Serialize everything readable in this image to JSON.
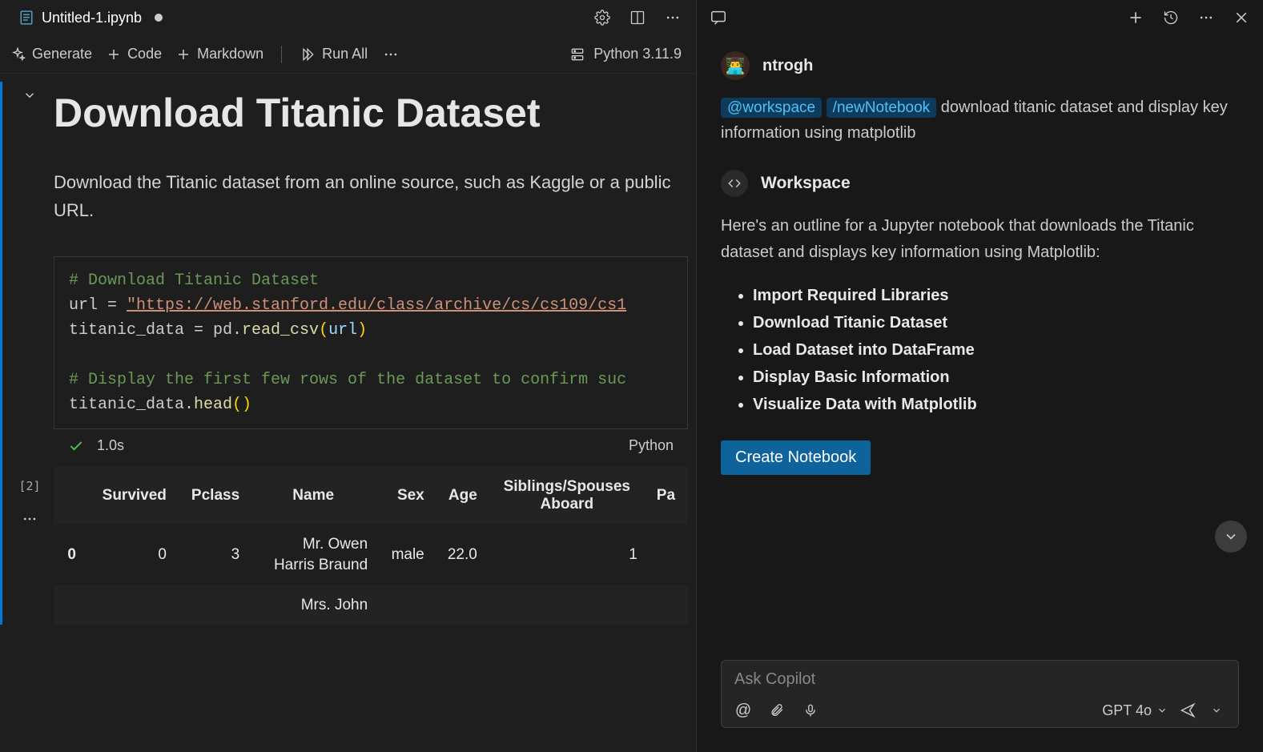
{
  "tab": {
    "filename": "Untitled-1.ipynb"
  },
  "toolbar": {
    "generate": "Generate",
    "code": "Code",
    "markdown": "Markdown",
    "runAll": "Run All",
    "kernel": "Python 3.11.9"
  },
  "notebook": {
    "heading": "Download Titanic Dataset",
    "paragraph": "Download the Titanic dataset from an online source, such as Kaggle or a public URL.",
    "exec_count": "[2]",
    "code": {
      "c1": "# Download Titanic Dataset",
      "l2a": "url = ",
      "l2b": "\"https://web.stanford.edu/class/archive/cs/cs109/cs1",
      "l3a": "titanic_data = pd.",
      "l3b": "read_csv",
      "l3c": "(",
      "l3d": "url",
      "l3e": ")",
      "c2": "# Display the first few rows of the dataset to confirm suc",
      "l5a": "titanic_data.",
      "l5b": "head",
      "l5c": "()"
    },
    "exec_time": "1.0s",
    "language": "Python",
    "table": {
      "headers": [
        "Survived",
        "Pclass",
        "Name",
        "Sex",
        "Age",
        "Siblings/Spouses Aboard",
        "Pa"
      ],
      "rows": [
        {
          "idx": "0",
          "survived": "0",
          "pclass": "3",
          "name": "Mr. Owen Harris Braund",
          "sex": "male",
          "age": "22.0",
          "sib": "1"
        },
        {
          "idx": "",
          "survived": "",
          "pclass": "",
          "name": "Mrs. John",
          "sex": "",
          "age": "",
          "sib": ""
        }
      ]
    }
  },
  "chat": {
    "username": "ntrogh",
    "mention": "@workspace",
    "slash": "/newNotebook",
    "prompt_text": "download titanic dataset and display key information using matplotlib",
    "ws_label": "Workspace",
    "ws_text": "Here's an outline for a Jupyter notebook that downloads the Titanic dataset and displays key information using Matplotlib:",
    "outline": [
      "Import Required Libraries",
      "Download Titanic Dataset",
      "Load Dataset into DataFrame",
      "Display Basic Information",
      "Visualize Data with Matplotlib"
    ],
    "create_btn": "Create Notebook",
    "input_placeholder": "Ask Copilot",
    "model": "GPT 4o"
  }
}
